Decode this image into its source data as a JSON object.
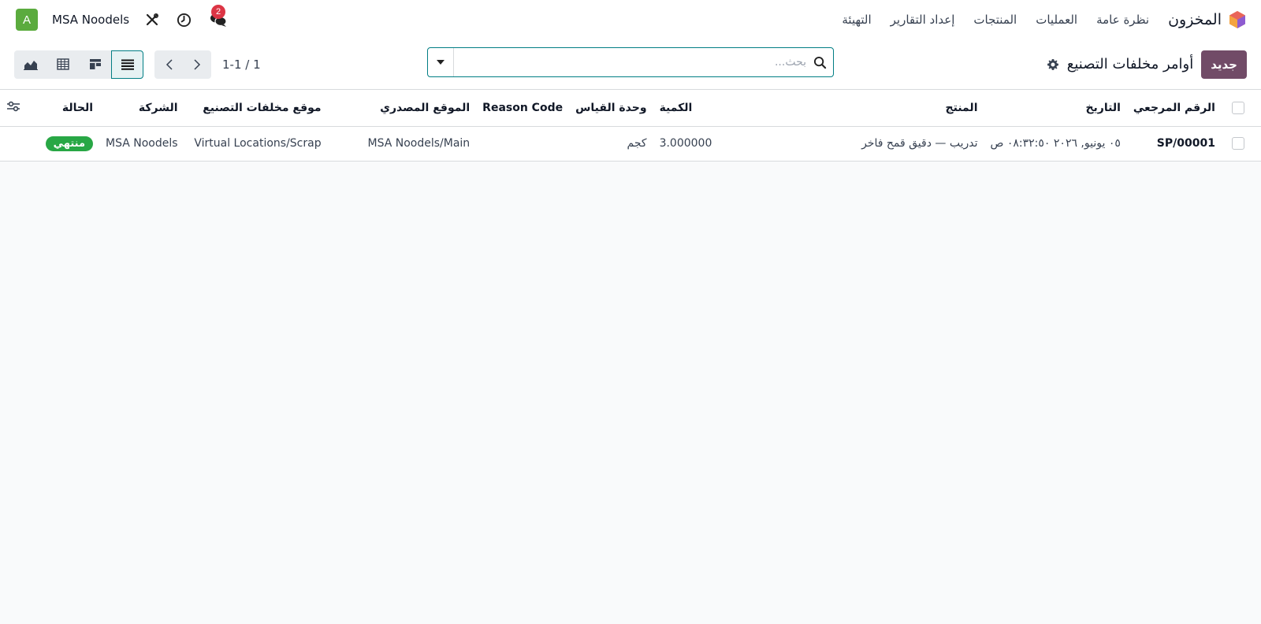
{
  "navbar": {
    "app_name": "المخزون",
    "menu": [
      "نظرة عامة",
      "العمليات",
      "المنتجات",
      "إعداد التقارير",
      "التهيئة"
    ],
    "company": "MSA Noodels",
    "avatar_letter": "A",
    "messages_count": "2",
    "icons": [
      "app-logo-icon",
      "chat-icon",
      "clock-icon",
      "tools-icon"
    ]
  },
  "control": {
    "new_label": "جديد",
    "title": "أوامر مخلفات التصنيع",
    "search_placeholder": "بحث...",
    "pager": "1-1 / 1",
    "views": [
      "list-view",
      "kanban-view",
      "pivot-view",
      "graph-view"
    ],
    "active_view": "list-view"
  },
  "table": {
    "columns": [
      "الرقم المرجعي",
      "التاريخ",
      "المنتج",
      "الكمية",
      "وحدة القياس",
      "Reason Code",
      "الموقع المصدري",
      "موقع مخلفات التصنيع",
      "الشركة",
      "الحالة"
    ],
    "rows": [
      {
        "reference": "SP/00001",
        "date": "٠٥ يونيو, ٢٠٢٦ ٠٨:٣٢:٥٠ ص",
        "product": "تدريب — دقيق قمح فاخر",
        "quantity": "3.000000",
        "uom": "كجم",
        "reason_code": "",
        "source_location": "MSA Noodels/Main",
        "scrap_location": "Virtual Locations/Scrap",
        "company": "MSA Noodels",
        "status": "منتهي"
      }
    ]
  },
  "colors": {
    "primary": "#714b67",
    "accent": "#017e84",
    "status_done": "#28a745",
    "avatar": "#5bab3e",
    "badge": "#dc3545"
  }
}
